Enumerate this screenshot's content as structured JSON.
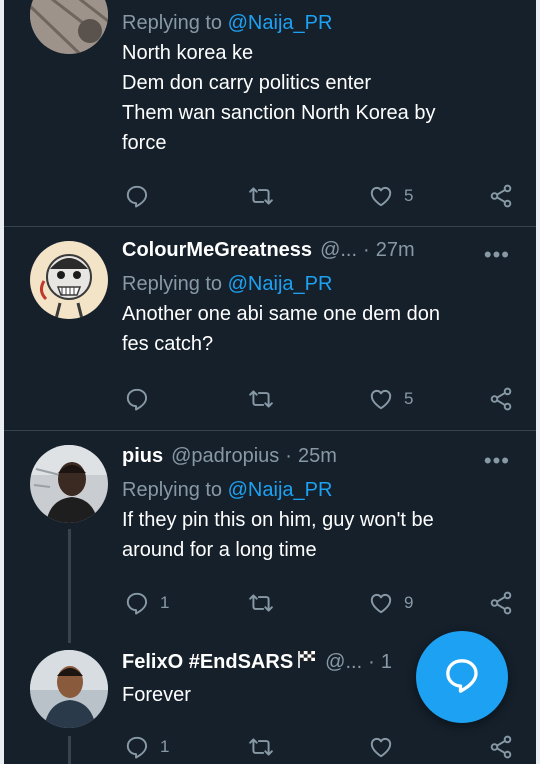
{
  "tweets": [
    {
      "name": "",
      "handle": "",
      "time": "",
      "reply_prefix": "Replying to",
      "reply_to": "@Naija_PR",
      "text_lines": [
        "North korea ke",
        "Dem don carry politics enter",
        "Them wan sanction North Korea by",
        "force"
      ],
      "reply_count": "",
      "retweet_count": "",
      "like_count": "5"
    },
    {
      "name": "ColourMeGreatness",
      "handle": "@...",
      "time": "27m",
      "reply_prefix": "Replying to",
      "reply_to": "@Naija_PR",
      "text_lines": [
        "Another one abi same one dem don",
        "fes catch?"
      ],
      "reply_count": "",
      "retweet_count": "",
      "like_count": "5"
    },
    {
      "name": "pius",
      "handle": "@padropius",
      "time": "25m",
      "reply_prefix": "Replying to",
      "reply_to": "@Naija_PR",
      "text_lines": [
        "If they pin this on him, guy won't be",
        "around for a long time"
      ],
      "reply_count": "1",
      "retweet_count": "",
      "like_count": "9"
    },
    {
      "name": "FelixO #EndSARS",
      "handle": "@...",
      "time": "1",
      "text_lines": [
        "Forever"
      ],
      "reply_count": "1",
      "retweet_count": "",
      "like_count": ""
    }
  ],
  "separator": "·",
  "more_glyph": "•••",
  "icons": {
    "reply": "reply-icon",
    "retweet": "retweet-icon",
    "like": "heart-icon",
    "share": "share-icon",
    "compose": "compose-reply-icon",
    "flag": "checkered-flag-icon"
  },
  "colors": {
    "background": "#15202b",
    "divider": "#38444d",
    "secondary_text": "#8899a6",
    "accent": "#1da1f2",
    "primary_text": "#ffffff"
  }
}
